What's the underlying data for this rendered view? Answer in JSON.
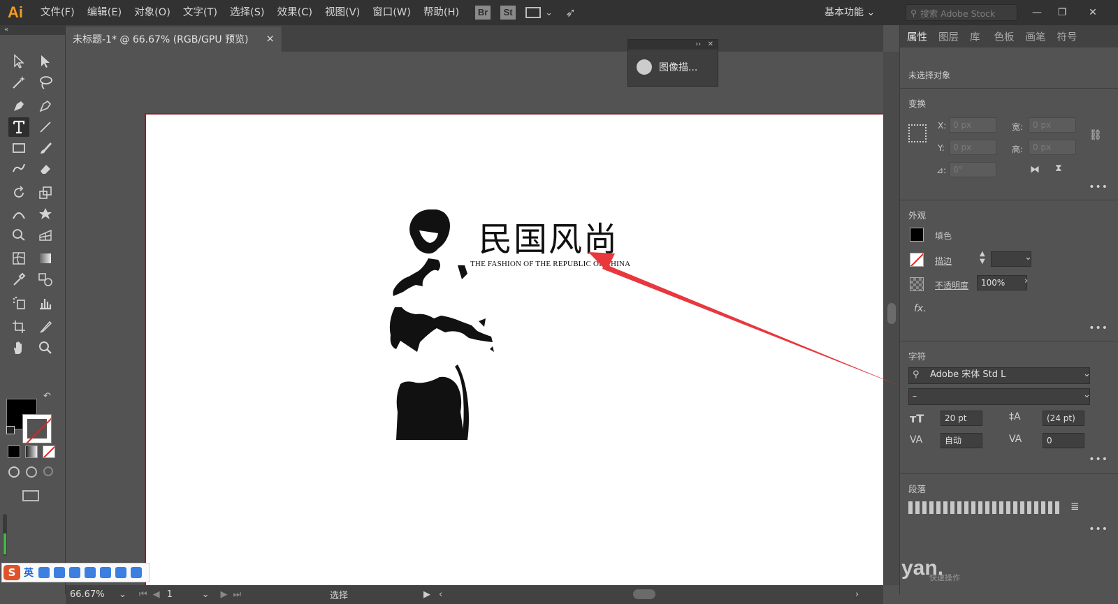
{
  "app": {
    "logo": "Ai"
  },
  "menu": {
    "items": [
      "文件(F)",
      "编辑(E)",
      "对象(O)",
      "文字(T)",
      "选择(S)",
      "效果(C)",
      "视图(V)",
      "窗口(W)",
      "帮助(H)"
    ],
    "bridge": "Br",
    "stock": "St",
    "workspace": "基本功能",
    "search_placeholder": "搜索 Adobe Stock"
  },
  "document": {
    "tab_title": "未标题-1* @ 66.67% (RGB/GPU 预览)",
    "close": "×"
  },
  "artwork": {
    "title": "民国风尚",
    "subtitle": "THE FASHION OF THE REPUBLIC OF CHINA"
  },
  "trace_panel": {
    "button_label": "图像描..."
  },
  "properties": {
    "tabs": [
      "属性",
      "图层",
      "库",
      "色板",
      "画笔",
      "符号"
    ],
    "active_tab": "属性",
    "no_selection": "未选择对象",
    "transform": {
      "title": "变换",
      "x_label": "X:",
      "x_value": "0 px",
      "y_label": "Y:",
      "y_value": "0 px",
      "w_label": "宽:",
      "w_value": "0 px",
      "h_label": "高:",
      "h_value": "0 px",
      "angle_label": "⊿:",
      "angle_value": "0°"
    },
    "appearance": {
      "title": "外观",
      "fill_label": "填色",
      "stroke_label": "描边",
      "opacity_label": "不透明度",
      "opacity_value": "100%",
      "fx_label": "fx."
    },
    "character": {
      "title": "字符",
      "font": "Adobe 宋体 Std L",
      "style": "–",
      "size": "20 pt",
      "leading": "(24 pt)",
      "kerning": "自动",
      "tracking": "0"
    },
    "paragraph": {
      "title": "段落"
    },
    "more": "•••"
  },
  "statusbar": {
    "zoom": "66.67%",
    "page": "1",
    "tool_status": "选择"
  },
  "ime": {
    "logo": "S",
    "lang": "英"
  },
  "watermark": {
    "text": "yan.",
    "sub": "快速操作"
  },
  "colors": {
    "accent_orange": "#f29c1f",
    "arrow_red": "#e8383d",
    "artboard_border": "#9a1c1c"
  }
}
